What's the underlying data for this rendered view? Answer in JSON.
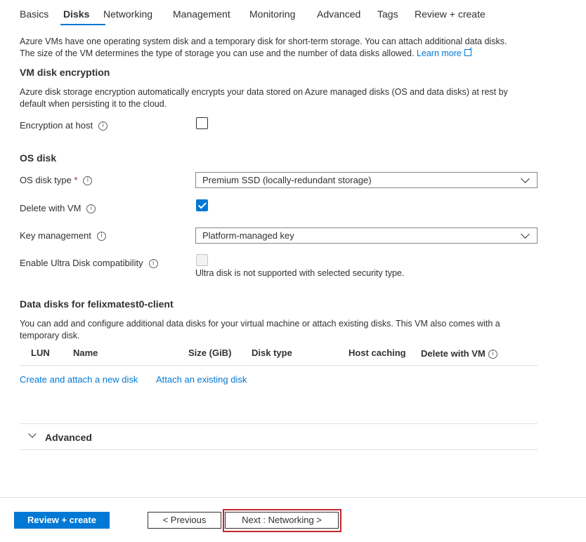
{
  "tabs": [
    {
      "label": "Basics"
    },
    {
      "label": "Disks"
    },
    {
      "label": "Networking"
    },
    {
      "label": "Management"
    },
    {
      "label": "Monitoring"
    },
    {
      "label": "Advanced"
    },
    {
      "label": "Tags"
    },
    {
      "label": "Review + create"
    }
  ],
  "active_tab": "Disks",
  "intro": {
    "line1": "Azure VMs have one operating system disk and a temporary disk for short-term storage. You can attach additional data disks.",
    "line2": "The size of the VM determines the type of storage you can use and the number of data disks allowed.",
    "learn_more": "Learn more"
  },
  "encryption": {
    "title": "VM disk encryption",
    "desc_line1": "Azure disk storage encryption automatically encrypts your data stored on Azure managed disks (OS and data disks) at rest by",
    "desc_line2": "default when persisting it to the cloud.",
    "host_label": "Encryption at host",
    "host_checked": false
  },
  "os_disk": {
    "title": "OS disk",
    "type_label": "OS disk type",
    "required_mark": "*",
    "type_value": "Premium SSD (locally-redundant storage)",
    "delete_label": "Delete with VM",
    "delete_checked": true,
    "key_label": "Key management",
    "key_value": "Platform-managed key",
    "ultra_label": "Enable Ultra Disk compatibility",
    "ultra_checked": false,
    "ultra_note": "Ultra disk is not supported with selected security type."
  },
  "data_disks": {
    "title": "Data disks for felixmatest0-client",
    "desc_line1": "You can add and configure additional data disks for your virtual machine or attach existing disks. This VM also comes with a",
    "desc_line2": "temporary disk.",
    "columns": [
      "LUN",
      "Name",
      "Size (GiB)",
      "Disk type",
      "Host caching",
      "Delete with VM"
    ],
    "create_link": "Create and attach a new disk",
    "attach_link": "Attach an existing disk"
  },
  "advanced": {
    "label": "Advanced"
  },
  "footer": {
    "review_button": "Review + create",
    "previous_button": "< Previous",
    "next_button": "Next : Networking >"
  }
}
